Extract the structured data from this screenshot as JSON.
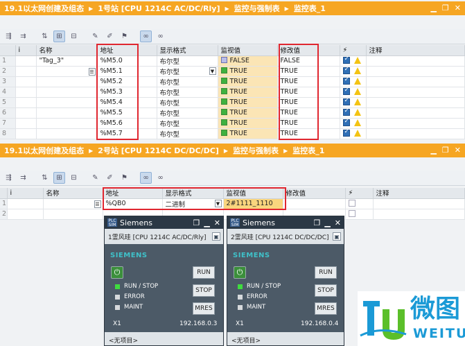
{
  "win1": {
    "breadcrumb": [
      "19.1以太网创建及组态",
      "1号站 [CPU 1214C AC/DC/Rly]",
      "监控与强制表",
      "监控表_1"
    ],
    "controls": [
      "▁",
      "❐",
      "✕"
    ],
    "columns": [
      "i",
      "名称",
      "地址",
      "显示格式",
      "监视值",
      "修改值",
      "⚡",
      "注释"
    ],
    "rows": [
      {
        "n": "1",
        "name": "\"Tag_3\"",
        "addr": "%M5.0",
        "fmt": "布尔型",
        "mon": "FALSE",
        "mod": "FALSE",
        "on": false
      },
      {
        "n": "2",
        "name": "",
        "addr": "%M5.1",
        "fmt": "布尔型",
        "mon": "TRUE",
        "mod": "TRUE",
        "on": true
      },
      {
        "n": "3",
        "name": "",
        "addr": "%M5.2",
        "fmt": "布尔型",
        "mon": "TRUE",
        "mod": "TRUE",
        "on": true
      },
      {
        "n": "4",
        "name": "",
        "addr": "%M5.3",
        "fmt": "布尔型",
        "mon": "TRUE",
        "mod": "TRUE",
        "on": true
      },
      {
        "n": "5",
        "name": "",
        "addr": "%M5.4",
        "fmt": "布尔型",
        "mon": "TRUE",
        "mod": "TRUE",
        "on": true
      },
      {
        "n": "6",
        "name": "",
        "addr": "%M5.5",
        "fmt": "布尔型",
        "mon": "TRUE",
        "mod": "TRUE",
        "on": true
      },
      {
        "n": "7",
        "name": "",
        "addr": "%M5.6",
        "fmt": "布尔型",
        "mon": "TRUE",
        "mod": "TRUE",
        "on": true
      },
      {
        "n": "8",
        "name": "",
        "addr": "%M5.7",
        "fmt": "布尔型",
        "mon": "TRUE",
        "mod": "TRUE",
        "on": true
      }
    ]
  },
  "win2": {
    "breadcrumb": [
      "19.1以太网创建及组态",
      "2号站 [CPU 1214C DC/DC/DC]",
      "监控与强制表",
      "监控表_1"
    ],
    "controls": [
      "▁",
      "❐",
      "✕"
    ],
    "columns": [
      "i",
      "名称",
      "地址",
      "显示格式",
      "监视值",
      "修改值",
      "⚡",
      "注释"
    ],
    "rows": [
      {
        "n": "1",
        "name": "",
        "addr": "%QB0",
        "fmt": "二进制",
        "mon": "2#1111_1110",
        "mod": ""
      },
      {
        "n": "2",
        "name": "",
        "addr": "",
        "fmt": "",
        "mon": "",
        "mod": ""
      }
    ]
  },
  "sim1": {
    "title": "Siemens",
    "station": "1霊风珪 [CPU 1214C AC/DC/Rly]",
    "brand": "SIEMENS",
    "leds": [
      "RUN / STOP",
      "ERROR",
      "MAINT"
    ],
    "buttons": [
      "RUN",
      "STOP",
      "MRES"
    ],
    "port": "X1",
    "ip": "192.168.0.3",
    "footer": "<无项目>"
  },
  "sim2": {
    "title": "Siemens",
    "station": "2霊风珪 [CPU 1214C DC/DC/DC]",
    "brand": "SIEMENS",
    "leds": [
      "RUN / STOP",
      "ERROR",
      "MAINT"
    ],
    "buttons": [
      "RUN",
      "STOP",
      "MRES"
    ],
    "port": "X1",
    "ip": "192.168.0.4",
    "footer": "<无项目>"
  },
  "logo": {
    "cn": "微图",
    "en": "WEITU"
  },
  "colors": {
    "accent": "#f6a623",
    "highlight": "#e0262f",
    "green_led": "#3fdc3f"
  }
}
